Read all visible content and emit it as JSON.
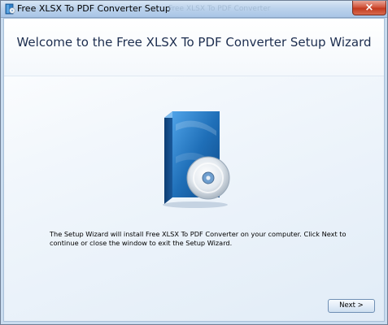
{
  "window": {
    "title": "Free XLSX To PDF Converter Setup",
    "background_title": "Free XLSX To PDF Converter",
    "close_glyph": "×"
  },
  "main": {
    "heading": "Welcome to the Free XLSX To PDF Converter Setup Wizard",
    "description": "The Setup Wizard will install Free XLSX To PDF Converter on your computer. Click Next to continue or close the window to exit the Setup Wizard.",
    "product_image": "software-box-with-cd-icon"
  },
  "footer": {
    "next_label": "Next >"
  },
  "colors": {
    "heading": "#1c2d4f",
    "box_blue": "#1f6fb8",
    "close_red": "#c23a1f"
  }
}
